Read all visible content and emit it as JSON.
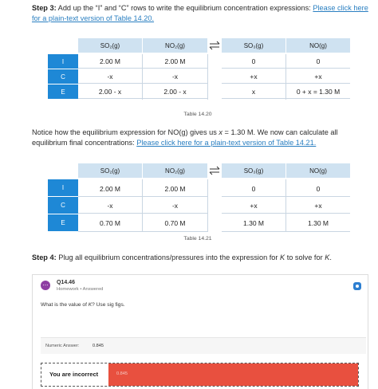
{
  "step3": {
    "label": "Step 3:",
    "text": " Add up the “I” and “C” rows to write the equilibrium concentration expressions: ",
    "link": "Please click here for a plain-text version of Table 14.20."
  },
  "table1": {
    "headers": [
      "SO₂(g)",
      "NO₂(g)",
      "SO₃(g)",
      "NO(g)"
    ],
    "rows": [
      {
        "label": "I",
        "cells": [
          "2.00 M",
          "2.00 M",
          "0",
          "0"
        ]
      },
      {
        "label": "C",
        "cells": [
          "-x",
          "-x",
          "+x",
          "+x"
        ]
      },
      {
        "label": "E",
        "cells": [
          "2.00 - x",
          "2.00 - x",
          "x",
          "0 + x = 1.30 M"
        ]
      }
    ],
    "caption": "Table 14.20"
  },
  "notice": {
    "text_a": "Notice how the equilibrium expression for NO(g) gives us ",
    "var": "x",
    "text_b": " = 1.30 M. We now can calculate all equilibrium final concentrations: ",
    "link": "Please click here for a plain-text version of Table 14.21."
  },
  "table2": {
    "headers": [
      "SO₂(g)",
      "NO₂(g)",
      "SO₃(g)",
      "NO(g)"
    ],
    "rows": [
      {
        "label": "I",
        "cells": [
          "2.00 M",
          "2.00 M",
          "0",
          "0"
        ]
      },
      {
        "label": "C",
        "cells": [
          "-x",
          "-x",
          "+x",
          "+x"
        ]
      },
      {
        "label": "E",
        "cells": [
          "0.70 M",
          "0.70 M",
          "1.30 M",
          "1.30 M"
        ]
      }
    ],
    "caption": "Table 14.21"
  },
  "step4": {
    "label": "Step 4:",
    "text_a": " Plug all equilibrium concentrations/pressures into the expression for ",
    "var1": "K",
    "text_b": " to solve for ",
    "var2": "K",
    "text_c": "."
  },
  "question": {
    "id": "Q14.46",
    "meta": "Homework  •  Answered",
    "text_a": "What is the value of ",
    "var": "K",
    "text_b": "? Use sig figs.",
    "numeric_label": "Numeric Answer:",
    "numeric_value": "0.845",
    "result_text": "You are incorrect",
    "result_value": "0.845",
    "badge_icon": "chat-bubble-icon",
    "accent": "#8e3fa3",
    "incorrect_color": "#e8503f"
  }
}
